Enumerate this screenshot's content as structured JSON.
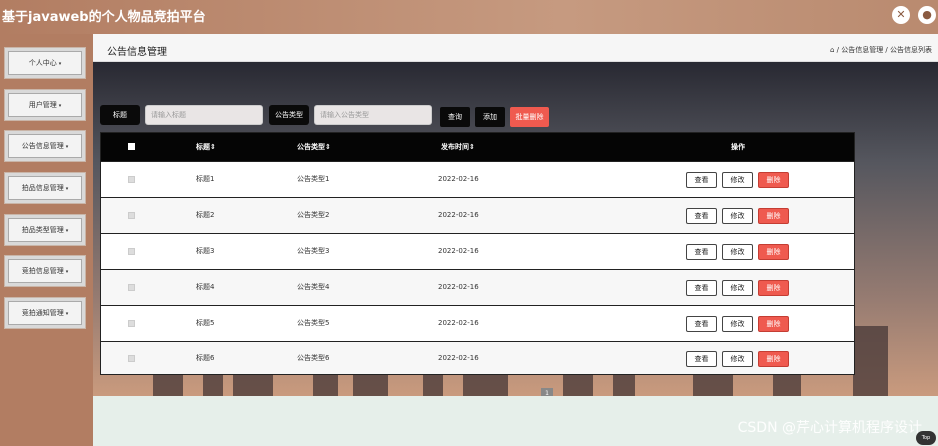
{
  "app": {
    "title": "基于javaweb的个人物品竞拍平台",
    "icons": [
      "fullscreen-icon",
      "user-icon"
    ]
  },
  "sidebar": {
    "items": [
      {
        "label": "个人中心"
      },
      {
        "label": "用户管理"
      },
      {
        "label": "公告信息管理"
      },
      {
        "label": "拍品信息管理"
      },
      {
        "label": "拍品类型管理"
      },
      {
        "label": "竞拍信息管理"
      },
      {
        "label": "竞拍通知管理"
      }
    ]
  },
  "header": {
    "page_title": "公告信息管理",
    "breadcrumb": "⌂ / 公告信息管理 / 公告信息列表"
  },
  "search": {
    "title_label": "标题",
    "title_placeholder": "请输入标题",
    "type_label": "公告类型",
    "type_placeholder": "请输入公告类型",
    "search_btn": "查询",
    "add_btn": "添加",
    "batch_delete_btn": "批量删除"
  },
  "table": {
    "headers": [
      "标题⇕",
      "公告类型⇕",
      "发布时间⇕",
      "操作"
    ],
    "rows": [
      {
        "title": "标题1",
        "type": "公告类型1",
        "date": "2022-02-16"
      },
      {
        "title": "标题2",
        "type": "公告类型2",
        "date": "2022-02-16"
      },
      {
        "title": "标题3",
        "type": "公告类型3",
        "date": "2022-02-16"
      },
      {
        "title": "标题4",
        "type": "公告类型4",
        "date": "2022-02-16"
      },
      {
        "title": "标题5",
        "type": "公告类型5",
        "date": "2022-02-16"
      },
      {
        "title": "标题6",
        "type": "公告类型6",
        "date": "2022-02-16"
      }
    ],
    "actions": {
      "view": "查看",
      "edit": "修改",
      "delete": "删除"
    }
  },
  "pagination": {
    "current": "1"
  },
  "watermark": "CSDN @芹心计算机程序设计",
  "back_to_top": "Top",
  "colors": {
    "accent_red": "#ef5a4f",
    "dark": "#0a0a0a",
    "sidebar": "#b27d62"
  }
}
